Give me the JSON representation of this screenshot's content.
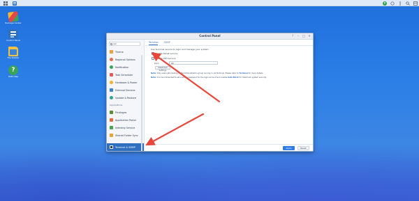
{
  "desktop": {
    "icons": [
      {
        "label": "Package Center",
        "icon": "package-center-icon"
      },
      {
        "label": "Control Panel",
        "icon": "control-panel-icon"
      },
      {
        "label": "File Station",
        "icon": "file-station-icon"
      },
      {
        "label": "DSM Help",
        "icon": "help-icon"
      }
    ]
  },
  "taskbar": {
    "apps": [
      "main-menu-icon",
      "control-panel-icon"
    ],
    "tray": [
      "user-icon",
      "notification-icon",
      "options-icon",
      "search-icon",
      "widgets-icon"
    ]
  },
  "window": {
    "title": "Control Panel",
    "controls": [
      "?",
      "–",
      "□",
      "✕"
    ],
    "search_value": "ssh",
    "sidebar": {
      "items": [
        {
          "label": "Theme",
          "color": "#e9a23b"
        },
        {
          "label": "Regional Options",
          "color": "#e46e49"
        },
        {
          "label": "Notification",
          "color": "#35a853"
        },
        {
          "label": "Task Scheduler",
          "color": "#e25c5c"
        },
        {
          "label": "Hardware & Power",
          "color": "#f1b32e"
        },
        {
          "label": "External Devices",
          "color": "#3c84d6"
        },
        {
          "label": "Update & Restore",
          "color": "#2fa58f"
        }
      ],
      "section_label": "Applications",
      "app_items": [
        {
          "label": "Privileges",
          "color": "#5a8f3a"
        },
        {
          "label": "Application Portal",
          "color": "#e06a3a"
        },
        {
          "label": "Indexing Service",
          "color": "#45a84b"
        },
        {
          "label": "Shared Folder Sync",
          "color": "#e6a532"
        },
        {
          "label": "Terminal & SNMP",
          "color": "#2a3a4f",
          "selected": true
        }
      ]
    },
    "tabs": [
      "Terminal",
      "SNMP"
    ],
    "description": "Use Terminal service to login and manage your system.",
    "telnet_label": "Enable Telnet service",
    "ssh_label": "Enable SSH service",
    "port_label": "Port:",
    "port_value": "22",
    "advanced_button": "Advanced Settings",
    "note1_prefix": "Note:",
    "note1_text": "Only users who belong to the administrators group can log in via Terminal. Please refer to",
    "note1_link": "Terminal",
    "note1_suffix": "for more details.",
    "note2_prefix": "Note:",
    "note2_text": "It is recommended to set a strong password for the login account and enable",
    "note2_link": "Auto Block",
    "note2_suffix": "for maximum system security.",
    "apply_label": "Apply",
    "reset_label": "Reset"
  },
  "colors": {
    "accent": "#2f6fbf",
    "annotation_arrow": "#e8463a"
  }
}
